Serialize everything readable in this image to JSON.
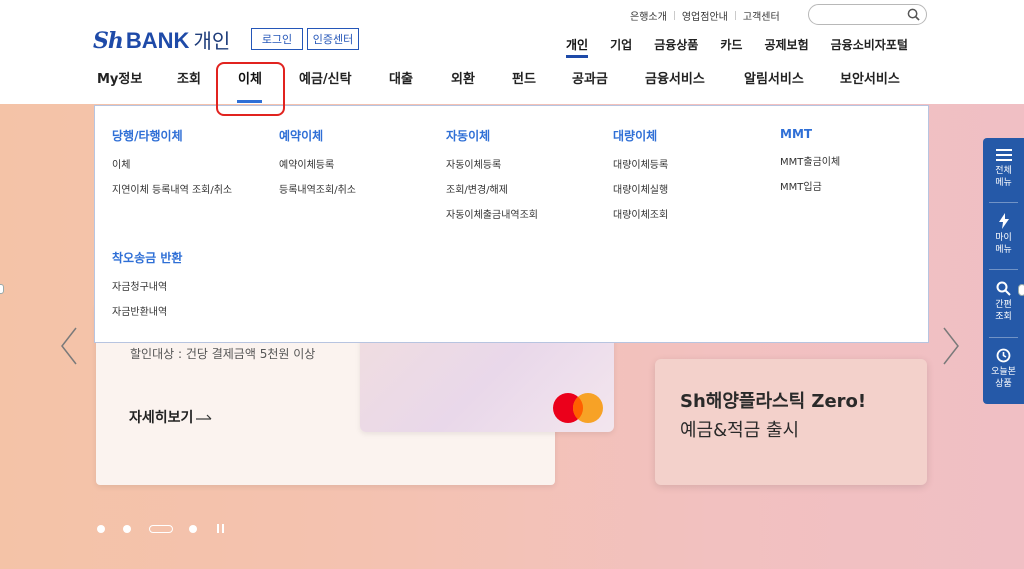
{
  "header": {
    "util_links": [
      "은행소개",
      "영업점안내",
      "고객센터"
    ],
    "search_placeholder": "",
    "logo_sh": "Sh",
    "logo_bank": "BANK",
    "logo_kind": "개인",
    "login_label": "로그인",
    "cert_label": "인증센터",
    "segment_tabs": [
      "개인",
      "기업",
      "금융상품",
      "카드",
      "공제보험",
      "금융소비자포털"
    ],
    "active_segment": "개인",
    "gnb": [
      "My정보",
      "조회",
      "이체",
      "예금/신탁",
      "대출",
      "외환",
      "펀드",
      "공과금",
      "금융서비스",
      "알림서비스",
      "보안서비스"
    ],
    "active_gnb": "이체"
  },
  "mega_menu": {
    "columns": [
      {
        "title": "당행/타행이체",
        "items": [
          "이체",
          "지연이체 등록내역 조회/취소"
        ]
      },
      {
        "title": "예약이체",
        "items": [
          "예약이체등록",
          "등록내역조회/취소"
        ]
      },
      {
        "title": "자동이체",
        "items": [
          "자동이체등록",
          "조회/변경/해제",
          "자동이체출금내역조회"
        ]
      },
      {
        "title": "대량이체",
        "items": [
          "대량이체등록",
          "대량이체실행",
          "대량이체조회"
        ]
      },
      {
        "title": "MMT",
        "items": [
          "MMT출금이체",
          "MMT입금"
        ]
      },
      {
        "title": "착오송금 반환",
        "items": [
          "자금청구내역",
          "자금반환내역"
        ]
      }
    ]
  },
  "banner": {
    "promo_text": "할인대상 : 건당 결제금액 5천원 이상",
    "detail_label": "자세히보기",
    "right_title": "Sh해양플라스틱 Zero!",
    "right_subtitle": "예금&적금 출시"
  },
  "quick_menu": {
    "items": [
      {
        "line1": "전체",
        "line2": "메뉴",
        "icon": "hamburger-icon"
      },
      {
        "line1": "마이",
        "line2": "메뉴",
        "icon": "lightning-icon"
      },
      {
        "line1": "간편",
        "line2": "조회",
        "icon": "search-icon"
      },
      {
        "line1": "오늘본",
        "line2": "상품",
        "icon": "clock-icon"
      }
    ]
  },
  "colors": {
    "brand_blue": "#1e4aa8",
    "menu_blue": "#2f6fd6",
    "quick_blue": "#2559a8",
    "highlight_red": "#e1231f"
  }
}
